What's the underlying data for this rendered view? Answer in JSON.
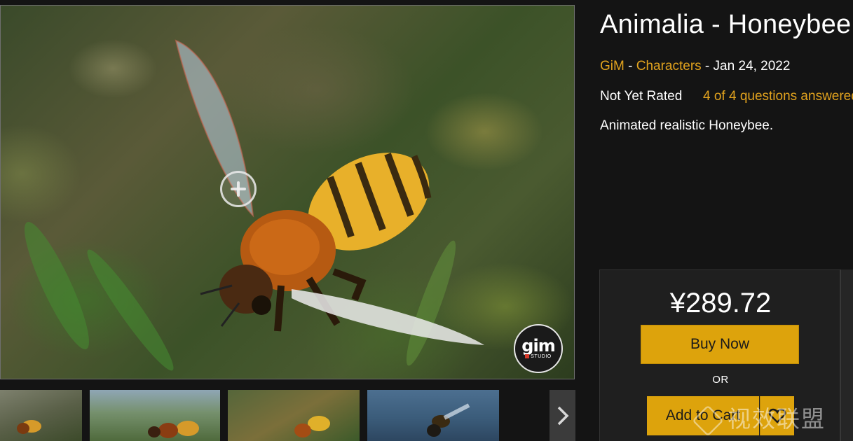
{
  "product": {
    "title": "Animalia - Honeybee",
    "publisher": "GiM",
    "separator1": " - ",
    "category": "Characters",
    "date": " - Jan 24, 2022",
    "rating": "Not Yet Rated",
    "questions": "4 of 4 questions answered",
    "description": "Animated realistic Honeybee."
  },
  "purchase": {
    "price": "¥289.72",
    "buy_now_label": "Buy Now",
    "or_label": "OR",
    "add_to_cart_label": "Add to Cart"
  },
  "gallery": {
    "logo_word": "gim",
    "logo_sub": "STUDIO",
    "thumbnail_count": 4
  },
  "watermark": "视效联盟",
  "colors": {
    "accent": "#e2a31e",
    "button": "#dda30c",
    "background": "#141414"
  },
  "icons": [
    "zoom-in-icon",
    "chevron-right-icon",
    "heart-icon"
  ]
}
